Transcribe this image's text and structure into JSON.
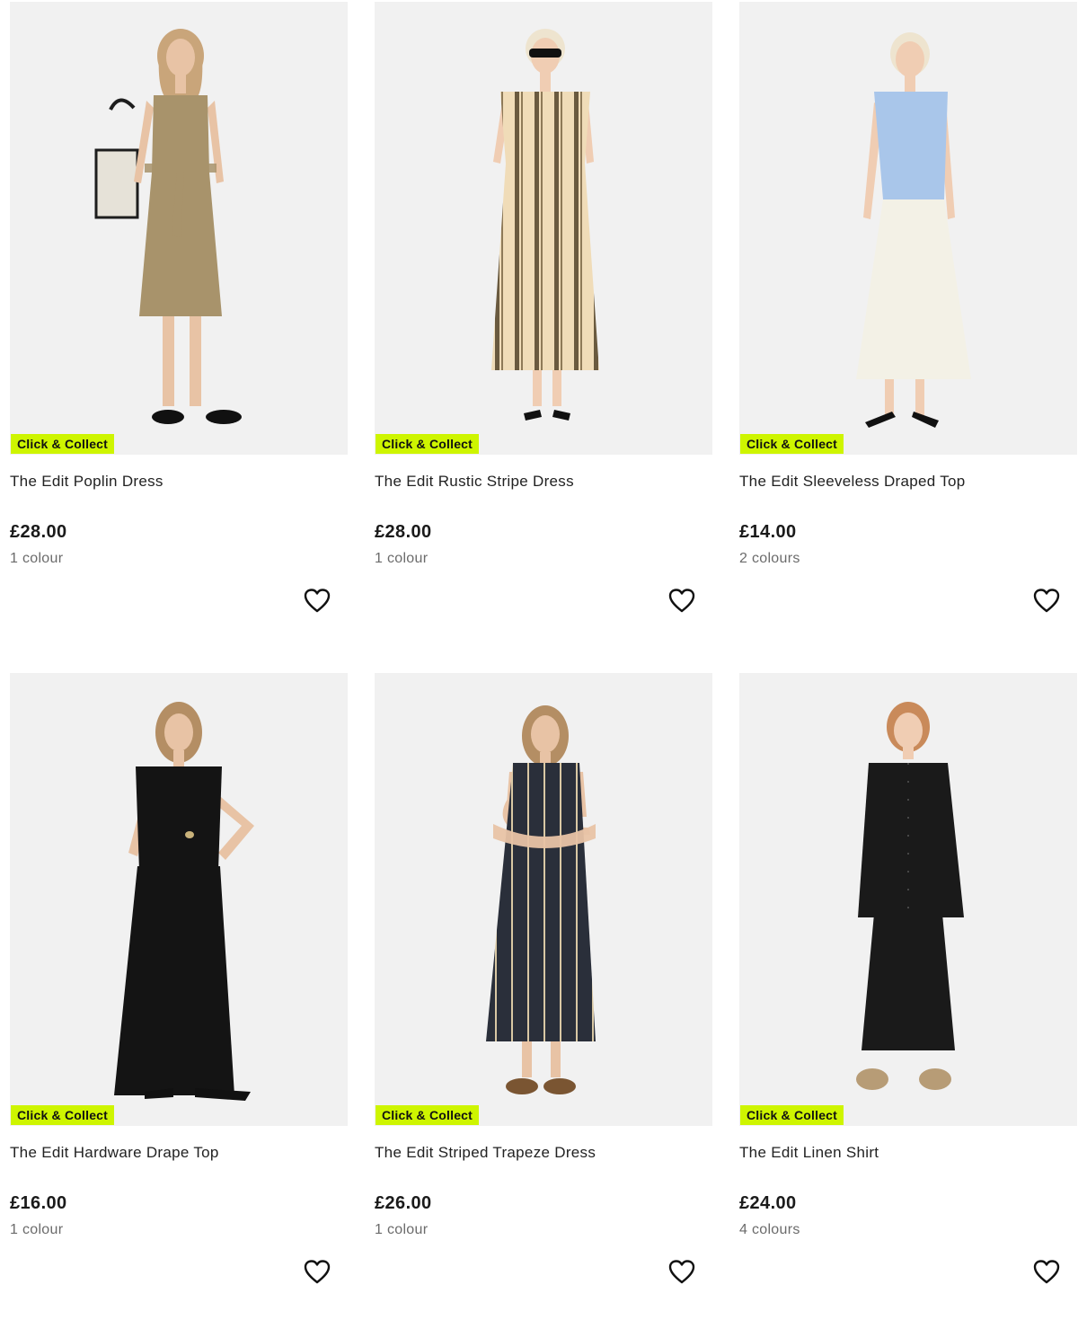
{
  "colors": {
    "badge_bg": "#cef500",
    "image_bg": "#f1f1f1",
    "text": "#222222",
    "muted_text": "#6b6b6b"
  },
  "products": [
    {
      "name": "The Edit Poplin Dress",
      "price": "£28.00",
      "colours": "1 colour",
      "badge": "Click & Collect",
      "favourite_icon": "heart-outline-icon",
      "garment_colors": [
        "#a8936b",
        "#a8936b"
      ],
      "skin": "#e8c3a5",
      "hair": "#c9a57a"
    },
    {
      "name": "The Edit Rustic Stripe Dress",
      "price": "£28.00",
      "colours": "1 colour",
      "badge": "Click & Collect",
      "favourite_icon": "heart-outline-icon",
      "garment_colors": [
        "#f0dcb8",
        "#f0dcb8"
      ],
      "skin": "#f0cdb3",
      "hair": "#eee4cf"
    },
    {
      "name": "The Edit Sleeveless Draped Top",
      "price": "£14.00",
      "colours": "2 colours",
      "badge": "Click & Collect",
      "favourite_icon": "heart-outline-icon",
      "garment_colors": [
        "#a9c6ea",
        "#f3f1e6"
      ],
      "skin": "#f0cdb3",
      "hair": "#eee4cf"
    },
    {
      "name": "The Edit Hardware Drape Top",
      "price": "£16.00",
      "colours": "1 colour",
      "badge": "Click & Collect",
      "favourite_icon": "heart-outline-icon",
      "garment_colors": [
        "#141414",
        "#141414"
      ],
      "skin": "#e8c3a5",
      "hair": "#b48e64"
    },
    {
      "name": "The Edit Striped Trapeze Dress",
      "price": "£26.00",
      "colours": "1 colour",
      "badge": "Click & Collect",
      "favourite_icon": "heart-outline-icon",
      "garment_colors": [
        "#2a2f3a",
        "#2a2f3a"
      ],
      "skin": "#e8c3a5",
      "hair": "#b48e64"
    },
    {
      "name": "The Edit Linen Shirt",
      "price": "£24.00",
      "colours": "4 colours",
      "badge": "Click & Collect",
      "favourite_icon": "heart-outline-icon",
      "garment_colors": [
        "#1a1a1a",
        "#1a1a1a"
      ],
      "skin": "#f0cdb3",
      "hair": "#c98a5a"
    }
  ]
}
